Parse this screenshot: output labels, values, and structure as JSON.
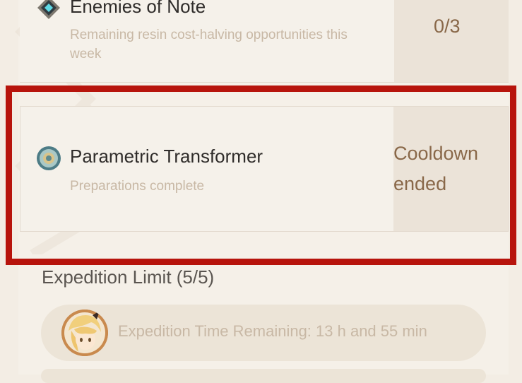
{
  "enemies": {
    "title": "Enemies of Note",
    "subtitle": "Remaining resin cost-halving opportunities this week",
    "status": "0/3"
  },
  "transformer": {
    "title": "Parametric Transformer",
    "subtitle": "Preparations complete",
    "status_line1": "Cooldown",
    "status_line2": "ended"
  },
  "expedition": {
    "header": "Expedition Limit (5/5)",
    "items": [
      {
        "text": "Expedition Time Remaining: 13 h and 55 min"
      }
    ]
  },
  "colors": {
    "highlight": "#b7140c",
    "status_text": "#896849",
    "subtitle_text": "#c8b8a5"
  }
}
